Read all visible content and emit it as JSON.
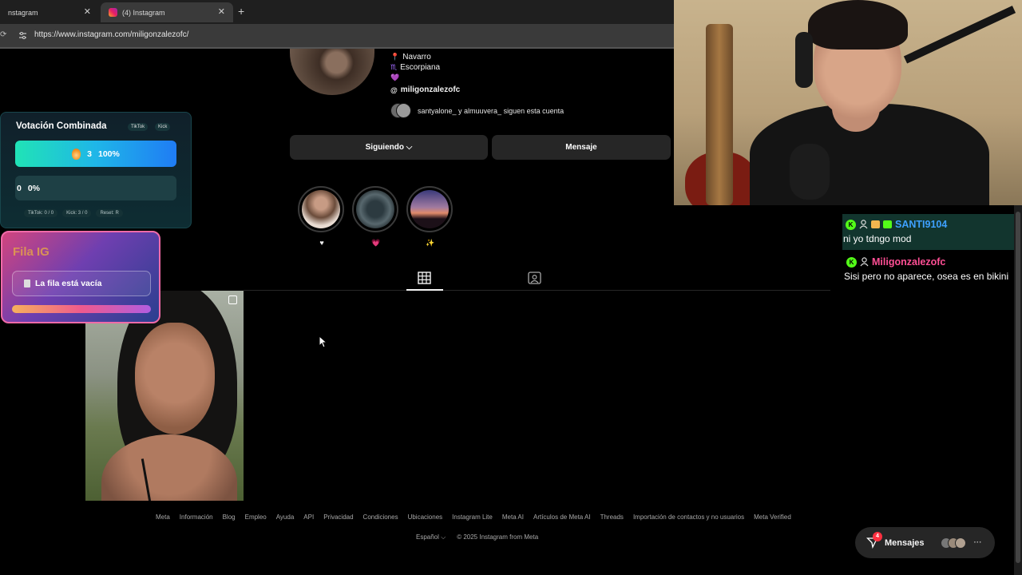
{
  "browser": {
    "tabs": [
      {
        "label": "nstagram"
      },
      {
        "label": "(4) Instagram"
      }
    ],
    "new_tab": "+",
    "close_symbol": "✕",
    "url": "https://www.instagram.com/miligonzalezofc/"
  },
  "profile": {
    "bio": {
      "location": "Navarro",
      "sign": "Escorpiana",
      "heart": "💜",
      "threads_handle": "miligonzalezofc"
    },
    "followed_by": "santyalone_ y almuuvera_ siguen esta cuenta",
    "following_button": "Siguiendo ⌵",
    "message_button": "Mensaje",
    "highlights": [
      {
        "label": "♥"
      },
      {
        "label": "💗"
      },
      {
        "label": "✨"
      }
    ]
  },
  "footer": {
    "links": [
      "Meta",
      "Información",
      "Blog",
      "Empleo",
      "Ayuda",
      "API",
      "Privacidad",
      "Condiciones",
      "Ubicaciones",
      "Instagram Lite",
      "Meta AI",
      "Artículos de Meta AI",
      "Threads",
      "Importación de contactos y no usuarios",
      "Meta Verified"
    ],
    "language": "Español ⌵",
    "copyright": "© 2025 Instagram from Meta"
  },
  "messages_pill": {
    "label": "Mensajes",
    "badge": "4",
    "more": "···"
  },
  "vote_widget": {
    "title": "Votación Combinada",
    "chip_tiktok": "TikTok",
    "chip_kick": "Kick",
    "bar1_count": "3",
    "bar1_percent": "100%",
    "bar2_count": "0",
    "bar2_percent": "0%",
    "stats": {
      "tiktok": "TikTok: 0 / 0",
      "kick": "Kick: 3 / 0",
      "reset": "Reset: R"
    }
  },
  "fila_widget": {
    "title": "Fila IG",
    "status": "La fila está vacía"
  },
  "chat": [
    {
      "user": "SANTI9104",
      "text": "ni yo tdngo mod",
      "color": "#3ea1ff"
    },
    {
      "user": "Miligonzalezofc",
      "text": "Sisi pero no aparece, osea es en bikini",
      "color": "#ff4f95"
    }
  ]
}
